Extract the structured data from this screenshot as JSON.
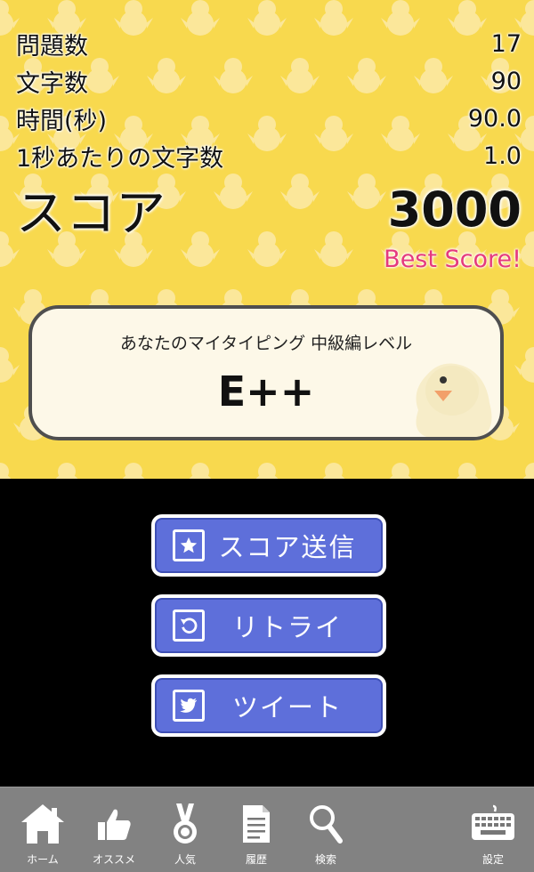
{
  "stats": [
    {
      "label": "問題数",
      "value": "17"
    },
    {
      "label": "文字数",
      "value": "90"
    },
    {
      "label": "時間(秒)",
      "value": "90.0"
    },
    {
      "label": "1秒あたりの文字数",
      "value": "1.0"
    }
  ],
  "score": {
    "label": "スコア",
    "value": "3000"
  },
  "best_score": "Best Score!",
  "level": {
    "caption": "あなたのマイタイピング 中級編レベル",
    "value": "E++"
  },
  "buttons": {
    "send_score": "スコア送信",
    "retry": "リトライ",
    "tweet": "ツイート"
  },
  "tabs": [
    "ホーム",
    "オススメ",
    "人気",
    "履歴",
    "検索",
    "設定"
  ],
  "colors": {
    "background": "#f8d94e",
    "button": "#5e6fda",
    "best_score": "#e5397d",
    "tabbar": "#828282"
  }
}
